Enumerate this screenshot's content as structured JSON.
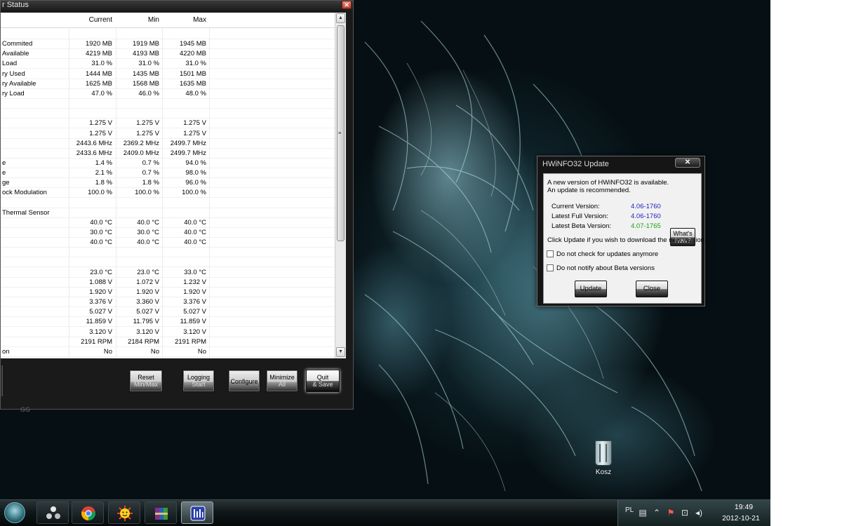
{
  "sensor_window": {
    "title": "r Status",
    "close_label": "✕",
    "columns": [
      "",
      "Current",
      "Min",
      "Max"
    ],
    "rows": [
      {
        "label": "",
        "current": "",
        "min": "",
        "max": ""
      },
      {
        "label": " Commited",
        "current": "1920 MB",
        "min": "1919 MB",
        "max": "1945 MB"
      },
      {
        "label": " Available",
        "current": "4219 MB",
        "min": "4193 MB",
        "max": "4220 MB"
      },
      {
        "label": " Load",
        "current": "31.0 %",
        "min": "31.0 %",
        "max": "31.0 %"
      },
      {
        "label": "ry Used",
        "current": "1444 MB",
        "min": "1435 MB",
        "max": "1501 MB"
      },
      {
        "label": "ry Available",
        "current": "1625 MB",
        "min": "1568 MB",
        "max": "1635 MB"
      },
      {
        "label": "ry Load",
        "current": "47.0 %",
        "min": "46.0 %",
        "max": "48.0 %"
      },
      {
        "label": "",
        "current": "",
        "min": "",
        "max": ""
      },
      {
        "label": "",
        "current": "",
        "min": "",
        "max": ""
      },
      {
        "label": "",
        "current": "1.275 V",
        "min": "1.275 V",
        "max": "1.275 V"
      },
      {
        "label": "",
        "current": "1.275 V",
        "min": "1.275 V",
        "max": "1.275 V"
      },
      {
        "label": "",
        "current": "2443.6 MHz",
        "min": "2369.2 MHz",
        "max": "2499.7 MHz"
      },
      {
        "label": "",
        "current": "2433.6 MHz",
        "min": "2409.0 MHz",
        "max": "2499.7 MHz"
      },
      {
        "label": "e",
        "current": "1.4 %",
        "min": "0.7 %",
        "max": "94.0 %"
      },
      {
        "label": "e",
        "current": "2.1 %",
        "min": "0.7 %",
        "max": "98.0 %"
      },
      {
        "label": "ge",
        "current": "1.8 %",
        "min": "1.8 %",
        "max": "96.0 %"
      },
      {
        "label": "ock Modulation",
        "current": "100.0 %",
        "min": "100.0 %",
        "max": "100.0 %"
      },
      {
        "label": "",
        "current": "",
        "min": "",
        "max": ""
      },
      {
        "label": " Thermal Sensor",
        "current": "",
        "min": "",
        "max": ""
      },
      {
        "label": "",
        "current": "40.0 °C",
        "min": "40.0 °C",
        "max": "40.0 °C"
      },
      {
        "label": "",
        "current": "30.0 °C",
        "min": "30.0 °C",
        "max": "40.0 °C"
      },
      {
        "label": "",
        "current": "40.0 °C",
        "min": "40.0 °C",
        "max": "40.0 °C"
      },
      {
        "label": "",
        "current": "",
        "min": "",
        "max": ""
      },
      {
        "label": "",
        "current": "",
        "min": "",
        "max": ""
      },
      {
        "label": "",
        "current": "23.0 °C",
        "min": "23.0 °C",
        "max": "33.0 °C"
      },
      {
        "label": "",
        "current": "1.088 V",
        "min": "1.072 V",
        "max": "1.232 V"
      },
      {
        "label": "",
        "current": "1.920 V",
        "min": "1.920 V",
        "max": "1.920 V"
      },
      {
        "label": "",
        "current": "3.376 V",
        "min": "3.360 V",
        "max": "3.376 V"
      },
      {
        "label": "",
        "current": "5.027 V",
        "min": "5.027 V",
        "max": "5.027 V"
      },
      {
        "label": "",
        "current": "11.859 V",
        "min": "11.795 V",
        "max": "11.859 V"
      },
      {
        "label": "",
        "current": "3.120 V",
        "min": "3.120 V",
        "max": "3.120 V"
      },
      {
        "label": "",
        "current": "2191 RPM",
        "min": "2184 RPM",
        "max": "2191 RPM"
      },
      {
        "label": "on",
        "current": "No",
        "min": "No",
        "max": "No"
      }
    ],
    "buttons": {
      "reset": [
        "Reset",
        "Min/Max"
      ],
      "logging": [
        "Logging",
        "Start"
      ],
      "configure": "Configure",
      "minimize": [
        "Minimize",
        "All"
      ],
      "quit": [
        "Quit",
        "& Save"
      ]
    },
    "footer_text": "GG"
  },
  "update_dialog": {
    "title": "HWiNFO32 Update",
    "close_label": "✕",
    "message_line1": "A new version of HWiNFO32 is available.",
    "message_line2": "An update is recommended.",
    "current_version_label": "Current Version:",
    "current_version": "4.06-1760",
    "latest_full_label": "Latest Full Version:",
    "latest_full": "4.06-1760",
    "latest_beta_label": "Latest Beta Version:",
    "latest_beta": "4.07-1765",
    "whats_new": [
      "What's",
      "New?"
    ],
    "instruction": "Click Update if you wish to download the new version.",
    "checkbox_no_updates": "Do not check for updates anymore",
    "checkbox_no_beta": "Do not notify about Beta versions",
    "update_button": "Update",
    "close_button": "Close"
  },
  "desktop": {
    "recycle_bin_label": "Kosz"
  },
  "taskbar": {
    "language": "PL",
    "time": "19:49",
    "date": "2012-10-21"
  }
}
